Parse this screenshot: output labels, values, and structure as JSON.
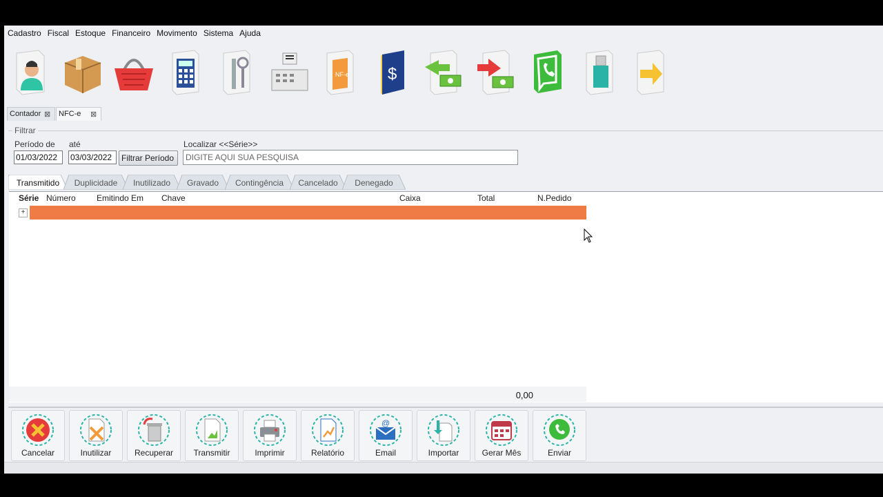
{
  "menu": [
    "Cadastro",
    "Fiscal",
    "Estoque",
    "Financeiro",
    "Movimento",
    "Sistema",
    "Ajuda"
  ],
  "toolbar_icons": [
    "user-icon",
    "box-icon",
    "basket-icon",
    "calculator-icon",
    "tools-icon",
    "cash-register-icon",
    "nfe-document-icon",
    "ledger-book-icon",
    "money-in-icon",
    "money-out-icon",
    "whatsapp-icon",
    "usb-drive-icon",
    "exit-arrow-icon"
  ],
  "doc_tabs": [
    {
      "label": "Contador"
    },
    {
      "label": "NFC-e"
    }
  ],
  "filter": {
    "legend": "Filtrar",
    "from_label": "Período de",
    "to_label": "até",
    "from_value": "01/03/2022",
    "to_value": "03/03/2022",
    "button": "Filtrar Período",
    "search_label": "Localizar <<Série>>",
    "search_placeholder": "DIGITE AQUI SUA PESQUISA"
  },
  "tabs": [
    "Transmitido",
    "Duplicidade",
    "Inutilizado",
    "Gravado",
    "Contingência",
    "Cancelado",
    "Denegado"
  ],
  "grid": {
    "columns": [
      "Série",
      "Número",
      "Emitindo Em",
      "Chave",
      "Caixa",
      "Total",
      "N.Pedido"
    ],
    "total": "0,00"
  },
  "actions": [
    "Cancelar",
    "Inutilizar",
    "Recuperar",
    "Transmitir",
    "Imprimir",
    "Relatório",
    "Email",
    "Importar",
    "Gerar Mês",
    "Enviar"
  ],
  "colors": {
    "row_highlight": "#f07c45",
    "accent_teal": "#2ab3a6",
    "window_bg": "#eef0f3"
  }
}
